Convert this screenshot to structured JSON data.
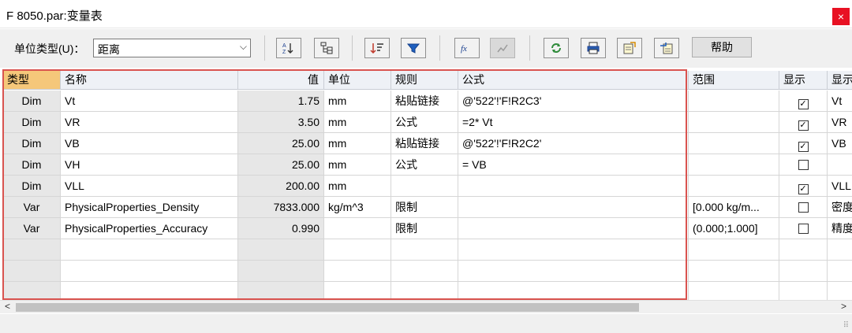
{
  "window": {
    "title": "F 8050.par:变量表",
    "close_label": "×"
  },
  "toolbar": {
    "unit_type_label": "单位类型(U)：",
    "unit_type_value": "距离",
    "unit_type_arrow": "⌵",
    "help_label": "帮助",
    "buttons": [
      {
        "icon": "sort-az-icon"
      },
      {
        "icon": "tree-view-icon"
      },
      {
        "icon": "sort-order-icon"
      },
      {
        "icon": "filter-icon"
      },
      {
        "icon": "formula-fx-icon"
      },
      {
        "icon": "graph-icon",
        "disabled": true
      },
      {
        "icon": "refresh-icon"
      },
      {
        "icon": "print-icon"
      },
      {
        "icon": "export-icon"
      },
      {
        "icon": "import-icon"
      }
    ]
  },
  "table": {
    "columns": [
      "类型",
      "名称",
      "值",
      "单位",
      "规则",
      "公式",
      "范围",
      "显示",
      "显示"
    ],
    "rows": [
      {
        "type": "Dim",
        "name": "Vt",
        "value": "1.75",
        "unit": "mm",
        "rule": "粘贴链接",
        "formula": "@'522'!'F!R2C3'",
        "range": "",
        "show": "✓",
        "display": "Vt"
      },
      {
        "type": "Dim",
        "name": "VR",
        "value": "3.50",
        "unit": "mm",
        "rule": "公式",
        "formula": "=2* Vt",
        "range": "",
        "show": "✓",
        "display": "VR"
      },
      {
        "type": "Dim",
        "name": "VB",
        "value": "25.00",
        "unit": "mm",
        "rule": "粘贴链接",
        "formula": "@'522'!'F!R2C2'",
        "range": "",
        "show": "✓",
        "display": "VB"
      },
      {
        "type": "Dim",
        "name": "VH",
        "value": "25.00",
        "unit": "mm",
        "rule": "公式",
        "formula": "= VB",
        "range": "",
        "show": "",
        "display": ""
      },
      {
        "type": "Dim",
        "name": "VLL",
        "value": "200.00",
        "unit": "mm",
        "rule": "",
        "formula": "",
        "range": "",
        "show": "✓",
        "display": "VLL"
      },
      {
        "type": "Var",
        "name": "PhysicalProperties_Density",
        "value": "7833.000",
        "unit": "kg/m^3",
        "rule": "限制",
        "formula": "",
        "range": "[0.000 kg/m...",
        "show": "",
        "display": "密度"
      },
      {
        "type": "Var",
        "name": "PhysicalProperties_Accuracy",
        "value": "0.990",
        "unit": "",
        "rule": "限制",
        "formula": "",
        "range": "(0.000;1.000]",
        "show": "",
        "display": "精度"
      },
      {
        "type": "",
        "name": "",
        "value": "",
        "unit": "",
        "rule": "",
        "formula": "",
        "range": "",
        "show": null,
        "display": ""
      },
      {
        "type": "",
        "name": "",
        "value": "",
        "unit": "",
        "rule": "",
        "formula": "",
        "range": "",
        "show": null,
        "display": ""
      },
      {
        "type": "",
        "name": "",
        "value": "",
        "unit": "",
        "rule": "",
        "formula": "",
        "range": "",
        "show": null,
        "display": ""
      }
    ]
  },
  "scrollbar": {
    "left_arrow": "<",
    "right_arrow": ">"
  },
  "statusbar": {
    "grip": "⠿"
  },
  "colors": {
    "selected_header": "#f5c77a",
    "highlight_border": "#d9534f",
    "close": "#e81123"
  }
}
